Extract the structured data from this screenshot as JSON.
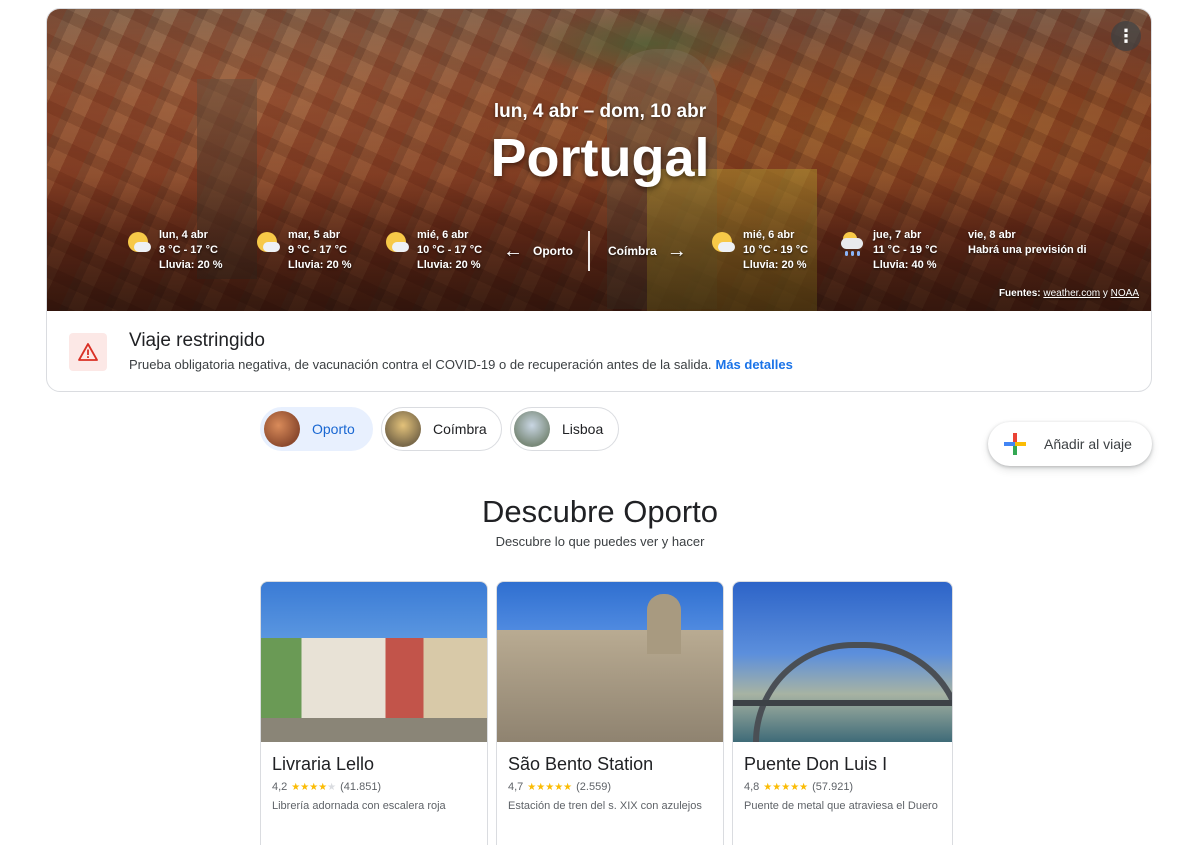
{
  "hero": {
    "dates": "lun, 4 abr – dom, 10 abr",
    "title": "Portugal",
    "menu_icon": "more-vert-icon",
    "sources_label": "Fuentes:",
    "source_1": "weather.com",
    "source_and": "y",
    "source_2": "NOAA"
  },
  "weather_left": [
    {
      "day": "lun, 4 abr",
      "temp": "8 °C - 17 °C",
      "rain": "Lluvia: 20 %",
      "icon": "partly-sunny-icon"
    },
    {
      "day": "mar, 5 abr",
      "temp": "9 °C - 17 °C",
      "rain": "Lluvia: 20 %",
      "icon": "partly-sunny-icon"
    },
    {
      "day": "mié, 6 abr",
      "temp": "10 °C - 17 °C",
      "rain": "Lluvia: 20 %",
      "icon": "partly-sunny-icon"
    }
  ],
  "city_nav": {
    "prev": "Oporto",
    "next": "Coímbra"
  },
  "weather_right": [
    {
      "day": "mié, 6 abr",
      "temp": "10 °C - 19 °C",
      "rain": "Lluvia: 20 %",
      "icon": "partly-sunny-icon"
    },
    {
      "day": "jue, 7 abr",
      "temp": "11 °C - 19 °C",
      "rain": "Lluvia: 40 %",
      "icon": "rain-cloud-icon"
    },
    {
      "day": "vie, 8 abr",
      "temp": "Habrá una previsión di",
      "rain": ""
    }
  ],
  "restriction": {
    "title": "Viaje restringido",
    "text": "Prueba obligatoria negativa, de vacunación contra el COVID-19 o de recuperación antes de la salida.",
    "link": "Más detalles",
    "color": "#d93025"
  },
  "chips": [
    {
      "label": "Oporto",
      "active": true
    },
    {
      "label": "Coímbra",
      "active": false
    },
    {
      "label": "Lisboa",
      "active": false
    }
  ],
  "add_trip": {
    "label": "Añadir al viaje"
  },
  "discover": {
    "title": "Descubre Oporto",
    "subtitle": "Descubre lo que puedes ver y hacer"
  },
  "places": [
    {
      "name": "Livraria Lello",
      "rating": "4,2",
      "stars": 4,
      "reviews": "(41.851)",
      "desc": "Librería adornada con escalera roja"
    },
    {
      "name": "São Bento Station",
      "rating": "4,7",
      "stars": 5,
      "reviews": "(2.559)",
      "desc": "Estación de tren del s. XIX con azulejos"
    },
    {
      "name": "Puente Don Luis I",
      "rating": "4,8",
      "stars": 5,
      "reviews": "(57.921)",
      "desc": "Puente de metal que atraviesa el Duero"
    }
  ],
  "colors": {
    "accent": "#1a73e8",
    "chip_active_bg": "#e8f0fe",
    "star": "#fbbc04"
  }
}
